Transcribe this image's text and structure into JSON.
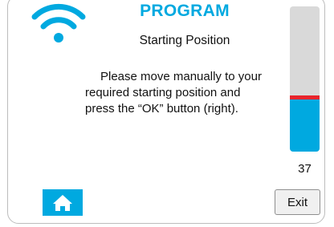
{
  "header": {
    "title": "PROGRAM",
    "subtitle": "Starting Position"
  },
  "message": {
    "line1": "Please move manually to your",
    "line2": "required starting position and",
    "line3": "press the “OK” button (right)."
  },
  "gauge": {
    "value": "37",
    "fill_fraction": 0.37,
    "marker_fraction": 0.37
  },
  "buttons": {
    "home_icon": "home-icon",
    "exit_label": "Exit"
  },
  "status": {
    "wifi_icon": "wifi-icon"
  },
  "colors": {
    "accent": "#00a9e0",
    "marker": "#e8242c",
    "track": "#d9d9d9"
  }
}
